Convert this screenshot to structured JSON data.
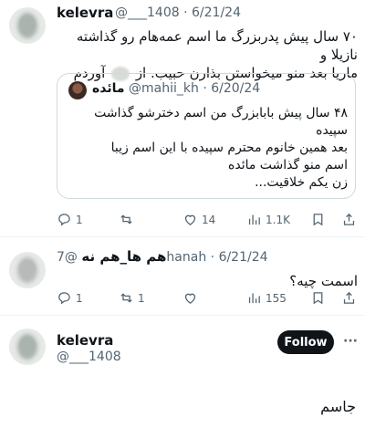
{
  "tweet1": {
    "author_name": "kelevra",
    "handle": "@___1408",
    "separator": "·",
    "date": "6/21/24",
    "text_line1": "۷۰ سال پیش پدربزرگ ما اسم عمه‌هام رو گذاشته نازیلا و",
    "text_line2": "ماریا بعد منو میخواستن بذارن حبیب. از",
    "text_line2b": "آوردم",
    "quote": {
      "author_name": "مائده",
      "handle": "@mahii_kh",
      "date": "6/20/24",
      "line1": "۴۸ سال پیش بابابزرگ من اسم دخترشو گذاشت",
      "line2": "سپیده",
      "line3": "بعد همین خانوم محترم سپیده با این اسم زیبا",
      "line4": "اسم منو گذاشت مائده",
      "line5": "زن یکم خلاقیت..."
    },
    "actions": {
      "replies": "1",
      "retweets": "",
      "likes": "14",
      "views": "1.1K"
    }
  },
  "tweet2": {
    "author_name": "هم ها_هم نه",
    "handle": "@7hanah",
    "date": "6/21/24",
    "text": "اسمت چیه؟",
    "actions": {
      "replies": "1",
      "retweets": "1",
      "likes": "",
      "views": "155"
    }
  },
  "tweet3": {
    "author_name": "kelevra",
    "handle": "@___1408",
    "follow_label": "Follow",
    "more": "···",
    "text": "جاسم"
  }
}
